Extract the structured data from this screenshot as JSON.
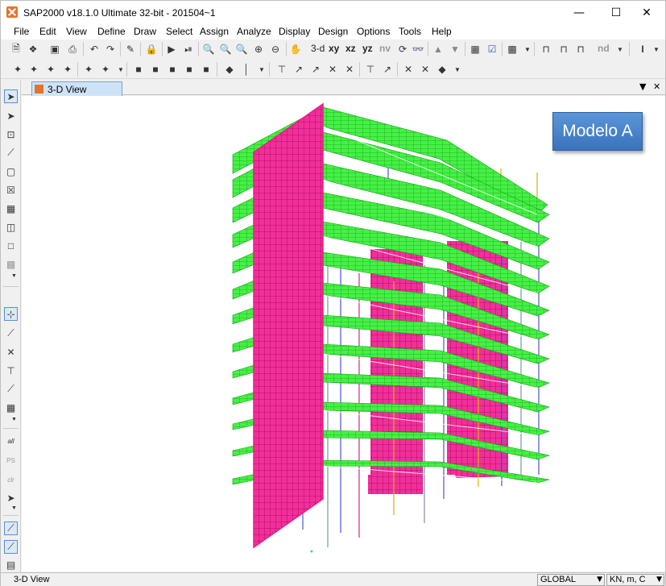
{
  "window": {
    "title": "SAP2000 v18.1.0 Ultimate 32-bit - 201504~1"
  },
  "menu": [
    "File",
    "Edit",
    "View",
    "Define",
    "Draw",
    "Select",
    "Assign",
    "Analyze",
    "Display",
    "Design",
    "Options",
    "Tools",
    "Help"
  ],
  "toolbar": {
    "view_3d_label": "3-d",
    "view_xy_label": "xy",
    "view_xz_label": "xz",
    "view_yz_label": "yz",
    "view_nv_label": "nv",
    "view_nd_label": "nd"
  },
  "left_toolbar": {
    "all_label": "all",
    "ps_label": "PS",
    "clr_label": "clr"
  },
  "tab": {
    "label": "3-D View"
  },
  "viewport": {
    "model_label": "Modelo A"
  },
  "statusbar": {
    "text": "3-D View",
    "coord_system": "GLOBAL",
    "units": "KN, m, C"
  },
  "colors": {
    "slab": "#33ee33",
    "wall": "#ee1a8a",
    "column": "#4a54d6",
    "column_alt": "#d6b400",
    "badge": "#4a86cd"
  }
}
